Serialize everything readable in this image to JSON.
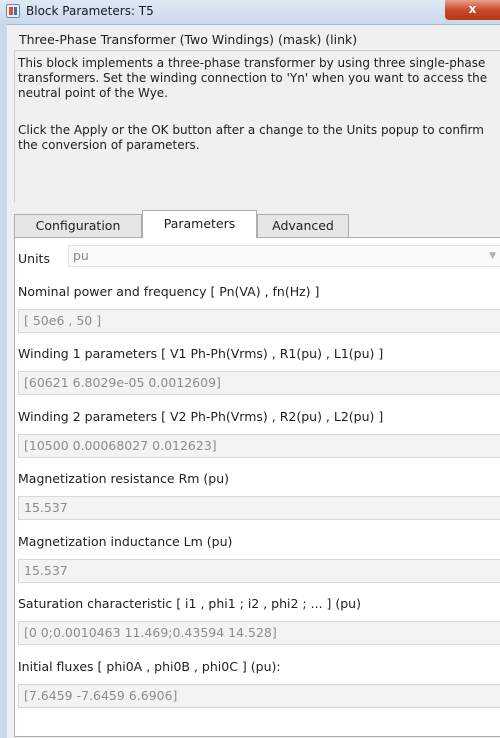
{
  "window": {
    "title": "Block Parameters: T5",
    "close_glyph": "x"
  },
  "mask": {
    "title": "Three-Phase Transformer (Two Windings) (mask) (link)",
    "description_1": "This block implements a three-phase transformer by using three single-phase transformers. Set the winding connection to 'Yn'  when you want to access the neutral point of the Wye.",
    "description_2": "Click the Apply or the OK button after a change to the Units popup to confirm the conversion of parameters."
  },
  "tabs": [
    {
      "label": "Configuration",
      "active": false
    },
    {
      "label": "Parameters",
      "active": true
    },
    {
      "label": "Advanced",
      "active": false
    }
  ],
  "units": {
    "label": "Units",
    "selected": "pu"
  },
  "params": [
    {
      "label": "Nominal power and frequency  [ Pn(VA) , fn(Hz) ]",
      "value": "[ 50e6 , 50 ]"
    },
    {
      "label": "Winding 1 parameters [ V1 Ph-Ph(Vrms) , R1(pu) , L1(pu) ]",
      "value": "[60621 6.8029e-05 0.0012609]"
    },
    {
      "label": "Winding 2 parameters [ V2 Ph-Ph(Vrms) , R2(pu) , L2(pu) ]",
      "value": "[10500 0.00068027 0.012623]"
    },
    {
      "label": "Magnetization resistance  Rm (pu)",
      "value": "15.537"
    },
    {
      "label": "Magnetization inductance  Lm (pu)",
      "value": "15.537"
    },
    {
      "label": "Saturation characteristic [ i1 ,  phi1 ;  i2 , phi2 ; ... ] (pu)",
      "value": "[0 0;0.0010463 11.469;0.43594 14.528]"
    },
    {
      "label": "Initial fluxes [ phi0A , phi0B , phi0C ] (pu):",
      "value": "[7.6459 -7.6459 6.6906]"
    }
  ]
}
